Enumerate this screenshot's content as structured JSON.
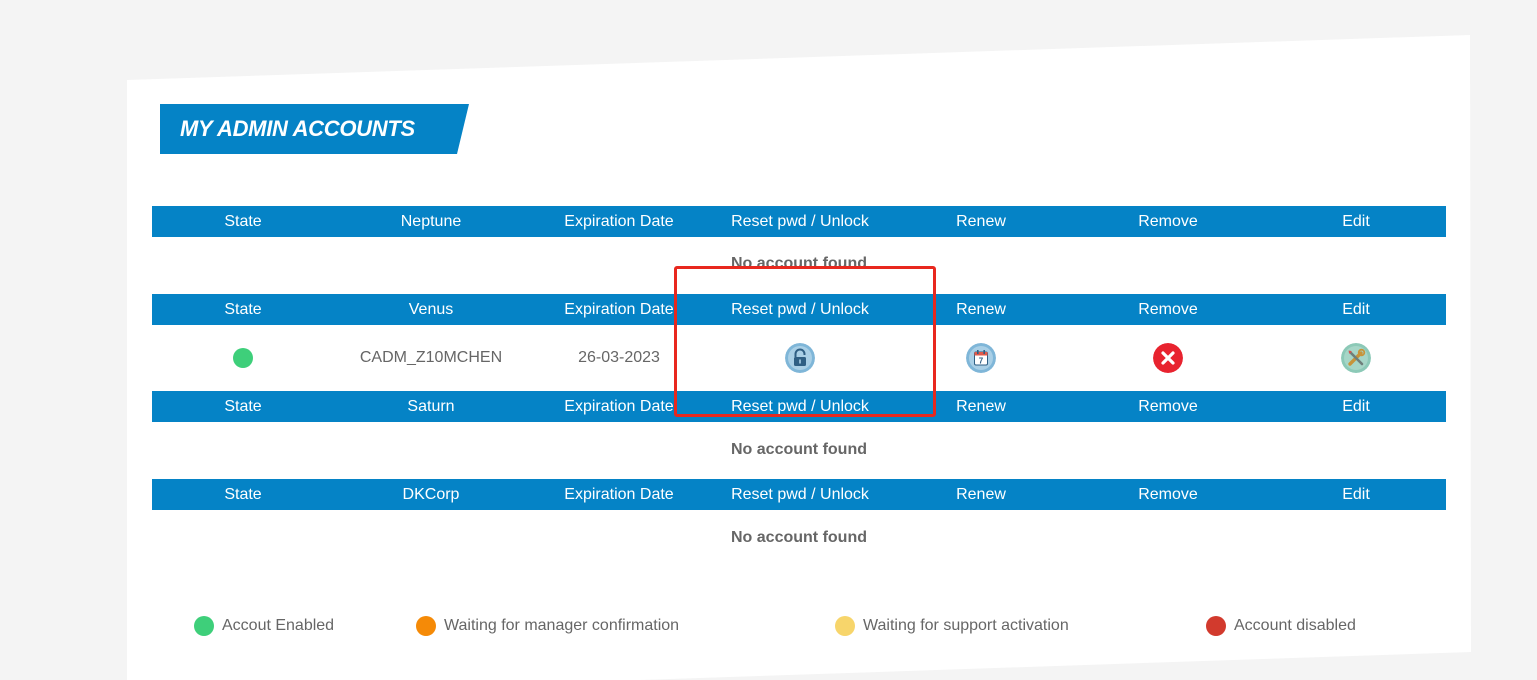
{
  "page": {
    "title": "MY ADMIN ACCOUNTS",
    "accent_color": "#0583c6"
  },
  "columns": {
    "state": "State",
    "expiration": "Expiration Date",
    "reset": "Reset pwd / Unlock",
    "renew": "Renew",
    "remove": "Remove",
    "edit": "Edit"
  },
  "sections": [
    {
      "name": "Neptune",
      "empty_message": "No account found"
    },
    {
      "name": "Venus",
      "rows": [
        {
          "state": "Account Enabled",
          "state_color": "#3ecf7a",
          "account": "CADM_Z10MCHEN",
          "expiration_date": "26-03-2023",
          "reset_icon": "lock-icon",
          "renew_icon": "calendar-icon",
          "calendar_day": "7",
          "remove_icon": "close-icon",
          "edit_icon": "tools-icon"
        }
      ]
    },
    {
      "name": "Saturn",
      "empty_message": "No account found"
    },
    {
      "name": "DKCorp",
      "empty_message": "No account found"
    }
  ],
  "legend": [
    {
      "label": "Accout Enabled",
      "color": "#3ecf7a"
    },
    {
      "label": "Waiting for manager confirmation",
      "color": "#f58a07"
    },
    {
      "label": "Waiting for support activation",
      "color": "#f7d56b"
    },
    {
      "label": "Account disabled",
      "color": "#d23a2d"
    }
  ]
}
